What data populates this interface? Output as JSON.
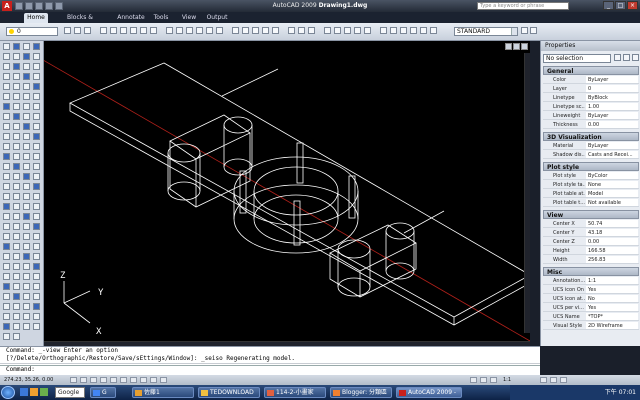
{
  "app": {
    "logo": "A",
    "title_prefix": "AutoCAD 2009 ",
    "title_file": "Drawing1.dwg",
    "search_placeholder": "Type a keyword or phrase"
  },
  "ribbon_tabs": [
    {
      "label": "Home",
      "active": true
    },
    {
      "label": "Blocks & References",
      "active": false
    },
    {
      "label": "Annotate",
      "active": false
    },
    {
      "label": "Tools",
      "active": false
    },
    {
      "label": "View",
      "active": false
    },
    {
      "label": "Output",
      "active": false
    }
  ],
  "layer_dropdown": "0",
  "text_style_dropdown": "STANDARD",
  "viewport": {
    "axis_z": "Z",
    "axis_y": "Y",
    "axis_x": "X",
    "grid_line_color": "#b0201a",
    "wire_color": "#ffffff"
  },
  "properties": {
    "title": "Properties",
    "selection": "No selection",
    "groups": [
      {
        "title": "General",
        "rows": [
          [
            "Color",
            "ByLayer"
          ],
          [
            "Layer",
            "0"
          ],
          [
            "Linetype",
            "ByBlock"
          ],
          [
            "Linetype sc...",
            "1.00"
          ],
          [
            "Lineweight",
            "ByLayer"
          ],
          [
            "Thickness",
            "0.00"
          ]
        ]
      },
      {
        "title": "3D Visualization",
        "rows": [
          [
            "Material",
            "ByLayer"
          ],
          [
            "Shadow dis...",
            "Casts and Recei..."
          ]
        ]
      },
      {
        "title": "Plot style",
        "rows": [
          [
            "Plot style",
            "ByColor"
          ],
          [
            "Plot style ta...",
            "None"
          ],
          [
            "Plot table at...",
            "Model"
          ],
          [
            "Plot table t...",
            "Not available"
          ]
        ]
      },
      {
        "title": "View",
        "rows": [
          [
            "Center X",
            "50.74"
          ],
          [
            "Center Y",
            "43.18"
          ],
          [
            "Center Z",
            "0.00"
          ],
          [
            "Height",
            "166.58"
          ],
          [
            "Width",
            "256.83"
          ]
        ]
      },
      {
        "title": "Misc",
        "rows": [
          [
            "Annotation...",
            "1:1"
          ],
          [
            "UCS icon On",
            "Yes"
          ],
          [
            "UCS icon at...",
            "No"
          ],
          [
            "UCS per vi...",
            "Yes"
          ],
          [
            "UCS Name",
            "*TOP*"
          ],
          [
            "Visual Style",
            "2D Wireframe"
          ]
        ]
      }
    ]
  },
  "command": {
    "line1": "Command: _-view Enter an option",
    "line2": "[?/Delete/Orthographic/Restore/Save/sEttings/Window]: _seiso Regenerating model.",
    "prompt": "Command:"
  },
  "status": {
    "coords": "274.23, 35.26, 0.00",
    "zoom": "1:1"
  },
  "taskbar": {
    "google_label": "Google",
    "tasks": [
      {
        "label": "G",
        "color": "#4285f4",
        "active": false
      },
      {
        "label": "佐藤1",
        "color": "#e8a030",
        "active": false
      },
      {
        "label": "TEDOWNLOAD",
        "color": "#f0c040",
        "active": false
      },
      {
        "label": "114-2-小畫家",
        "color": "#e06040",
        "active": false
      },
      {
        "label": "Blogger: 分類區",
        "color": "#f08030",
        "active": false
      },
      {
        "label": "AutoCAD 2009 -",
        "color": "#c8201c",
        "active": true
      }
    ],
    "clock": "下午 07:01"
  }
}
